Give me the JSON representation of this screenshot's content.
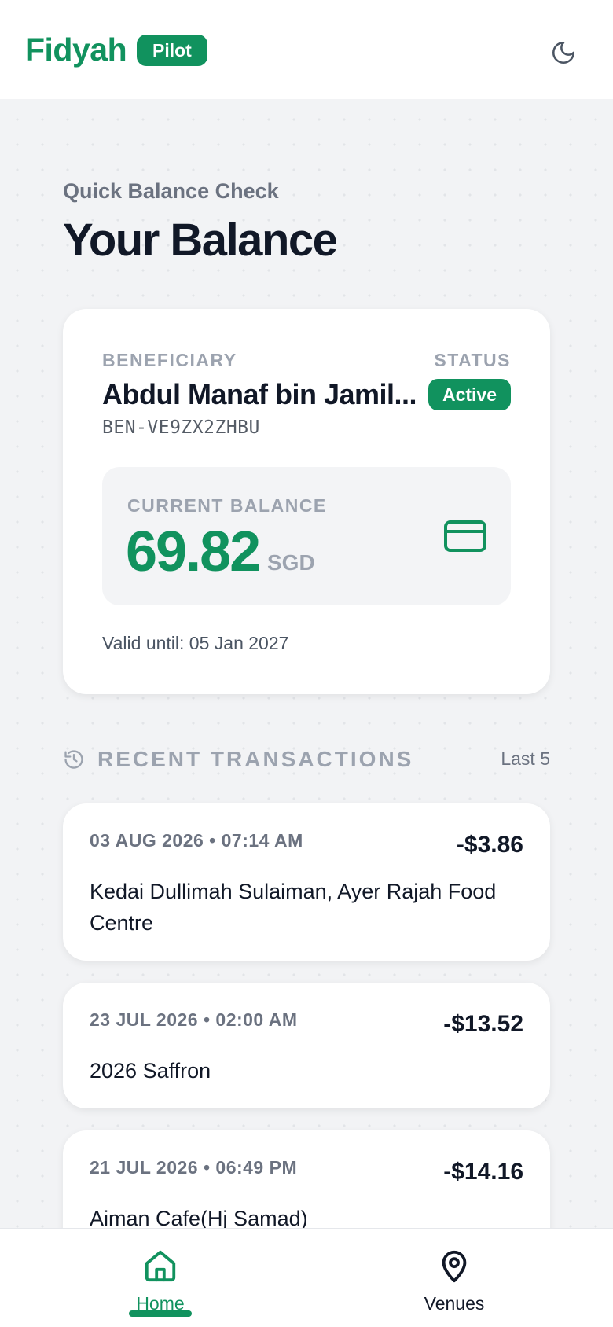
{
  "header": {
    "brand": "Fidyah",
    "badge": "Pilot",
    "theme_toggle_icon": "moon-icon"
  },
  "page": {
    "eyebrow": "Quick Balance Check",
    "title": "Your Balance"
  },
  "beneficiary": {
    "label": "BENEFICIARY",
    "name": "Abdul Manaf bin Jamil...",
    "id": "BEN-VE9ZX2ZHBU",
    "status_label": "STATUS",
    "status": "Active"
  },
  "balance": {
    "label": "CURRENT BALANCE",
    "amount": "69.82",
    "currency": "SGD",
    "icon": "credit-card-icon",
    "valid_until": "Valid until: 05 Jan 2027"
  },
  "recent": {
    "title": "RECENT TRANSACTIONS",
    "count_label": "Last 5",
    "icon": "history-icon",
    "transactions": [
      {
        "date": "03 AUG 2026 • 07:14 AM",
        "amount": "-$3.86",
        "merchant": "Kedai Dullimah Sulaiman, Ayer Rajah Food Centre"
      },
      {
        "date": "23 JUL 2026 • 02:00 AM",
        "amount": "-$13.52",
        "merchant": "2026 Saffron"
      },
      {
        "date": "21 JUL 2026 • 06:49 PM",
        "amount": "-$14.16",
        "merchant": "Aiman Cafe(Hj Samad)"
      }
    ]
  },
  "nav": {
    "items": [
      {
        "label": "Home",
        "icon": "home-icon",
        "active": true
      },
      {
        "label": "Venues",
        "icon": "map-pin-icon",
        "active": false
      }
    ]
  },
  "colors": {
    "brand": "#11925e",
    "text": "#111827",
    "muted": "#9ca3af",
    "background": "#f2f3f5"
  }
}
